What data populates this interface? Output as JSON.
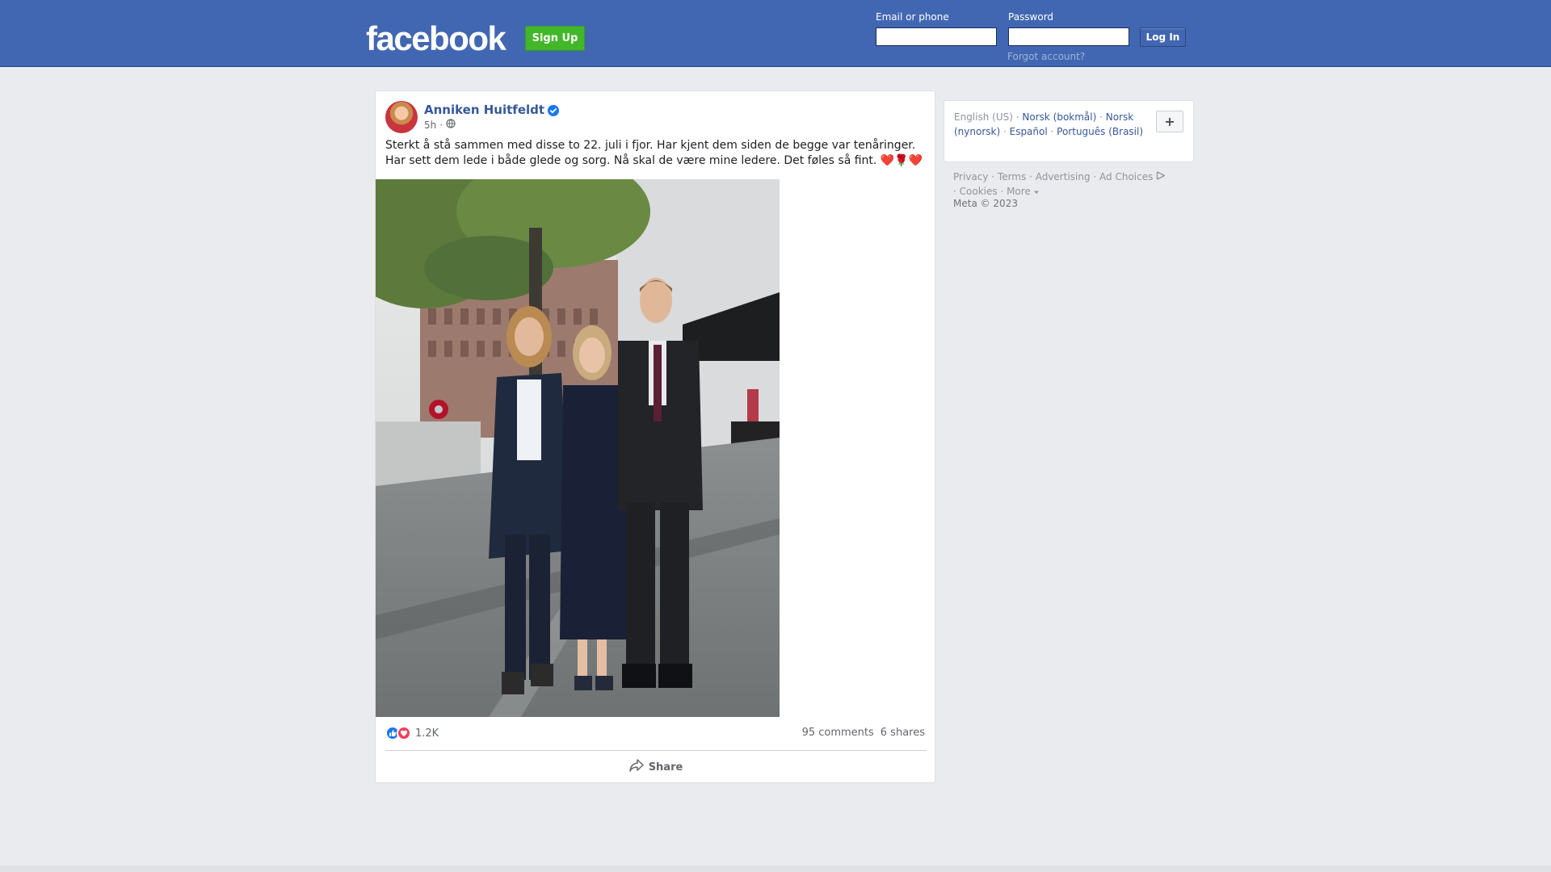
{
  "header": {
    "logo": "facebook",
    "signup_label": "Sign Up",
    "email_label": "Email or phone",
    "password_label": "Password",
    "email_value": "",
    "password_value": "",
    "login_label": "Log In",
    "forgot_label": "Forgot account?"
  },
  "post": {
    "author": "Anniken Huitfeldt",
    "time": "5h",
    "separator": "·",
    "text_line1": "Sterkt å stå sammen med disse to 22. juli i fjor. Har kjent dem siden de begge var tenåringer.",
    "text_line2": "Har sett dem lede i både glede og sorg. Nå skal de være mine ledere. Det føles så fint. ❤️🌹❤️",
    "reactions_count": "1.2K",
    "comments": "95 comments",
    "shares": "6 shares",
    "share_label": "Share"
  },
  "sidebar": {
    "languages": {
      "current": "English (US)",
      "options": [
        "Norsk (bokmål)",
        "Norsk (nynorsk)",
        "Español",
        "Português (Brasil)"
      ],
      "more_label": "+"
    },
    "footer": {
      "links": [
        "Privacy",
        "Terms",
        "Advertising",
        "Ad Choices",
        "Cookies",
        "More"
      ],
      "copyright": "Meta © 2023"
    }
  },
  "colors": {
    "brand_blue": "#4267b2",
    "signup_green": "#42b72a",
    "link_blue": "#365899",
    "like_blue": "#1877f2",
    "love_red": "#f33e58"
  },
  "icons": [
    "verified-badge-icon",
    "globe-icon",
    "like-icon",
    "love-icon",
    "share-icon",
    "ad-choices-icon",
    "caret-down-icon"
  ]
}
